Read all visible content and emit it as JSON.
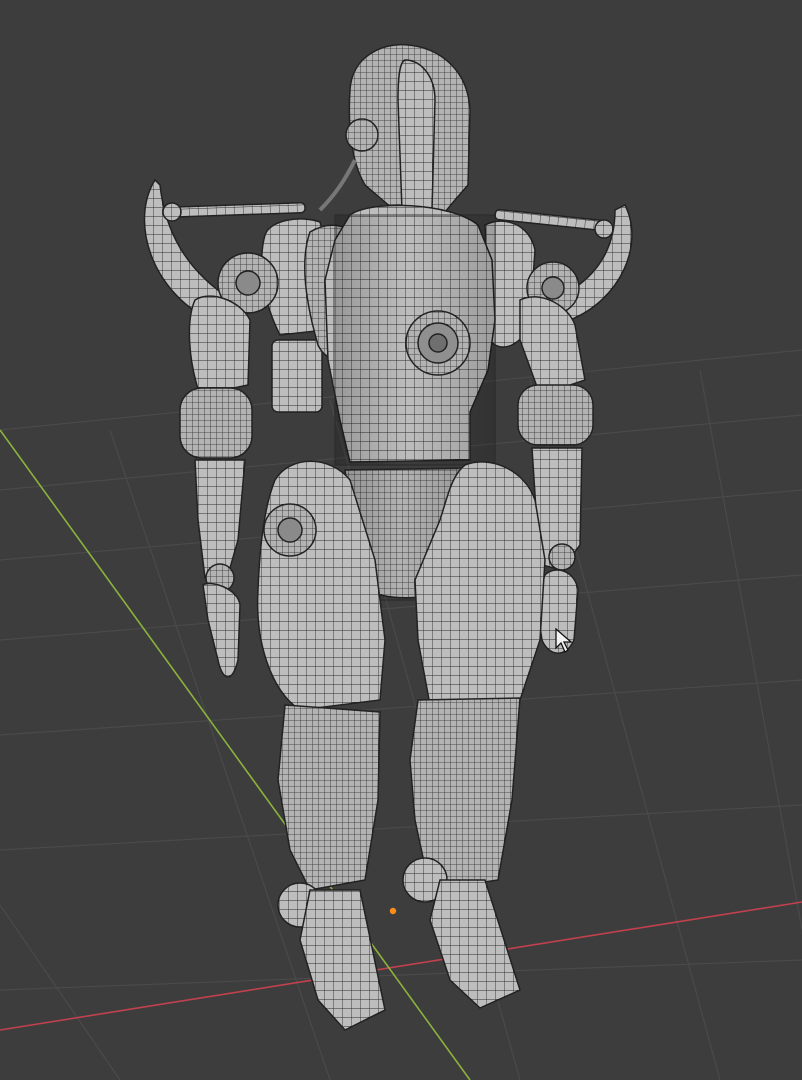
{
  "viewport": {
    "view": "3D Viewport",
    "shading": "wireframe-overlay",
    "background_color": "#3d3d3d",
    "grid_color": "#4a4a4a",
    "x_axis_color": "#c2414e",
    "y_axis_color": "#8cb23e",
    "origin_color": "#ff8c1a"
  },
  "object": {
    "type": "mesh",
    "subject": "robot",
    "mesh_color": "#b9b9b9",
    "edge_color": "#2a2a2a"
  },
  "cursor": {
    "icon": "arrow-cursor-icon"
  }
}
